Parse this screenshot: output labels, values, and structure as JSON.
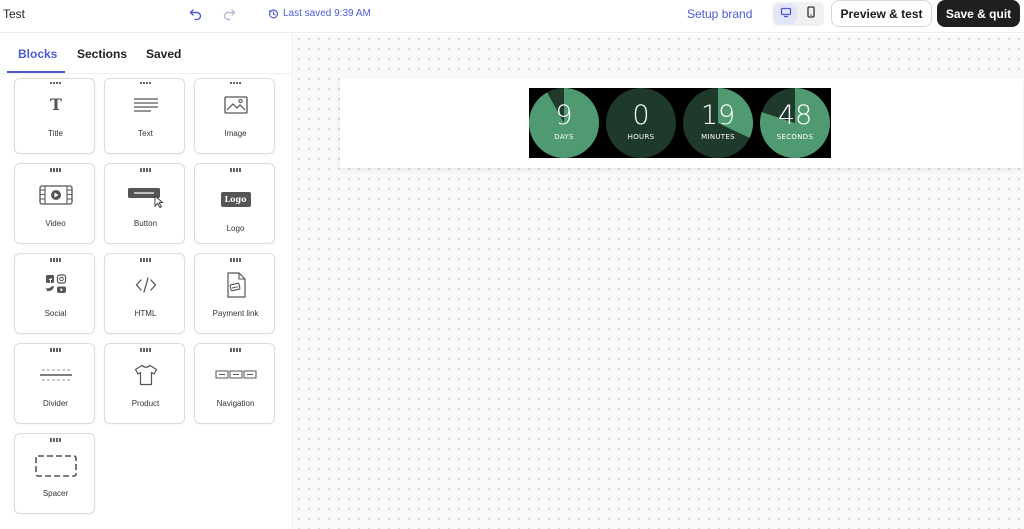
{
  "header": {
    "doc_title": "Test",
    "last_saved": "Last saved 9:39 AM",
    "setup_brand": "Setup brand",
    "preview_label": "Preview & test",
    "save_label": "Save & quit"
  },
  "sidebar": {
    "tabs": [
      {
        "label": "Blocks",
        "active": true
      },
      {
        "label": "Sections",
        "active": false
      },
      {
        "label": "Saved",
        "active": false
      }
    ],
    "blocks": [
      {
        "label": "Title",
        "icon": "title-icon"
      },
      {
        "label": "Text",
        "icon": "text-icon"
      },
      {
        "label": "Image",
        "icon": "image-icon"
      },
      {
        "label": "Video",
        "icon": "video-icon"
      },
      {
        "label": "Button",
        "icon": "button-icon"
      },
      {
        "label": "Logo",
        "icon": "logo-icon",
        "icon_text": "Logo"
      },
      {
        "label": "Social",
        "icon": "social-icon"
      },
      {
        "label": "HTML",
        "icon": "html-icon"
      },
      {
        "label": "Payment link",
        "icon": "payment-link-icon"
      },
      {
        "label": "Divider",
        "icon": "divider-icon"
      },
      {
        "label": "Product",
        "icon": "product-icon"
      },
      {
        "label": "Navigation",
        "icon": "navigation-icon"
      },
      {
        "label": "Spacer",
        "icon": "spacer-icon"
      }
    ]
  },
  "countdown": {
    "units": [
      {
        "value": "9",
        "label": "DAYS"
      },
      {
        "value": "0",
        "label": "HOURS"
      },
      {
        "value": "19",
        "label": "MINUTES"
      },
      {
        "value": "48",
        "label": "SECONDS"
      }
    ],
    "colors": {
      "dark": "#1f3a2b",
      "light": "#4f9a70",
      "bg": "#000000"
    }
  },
  "colors": {
    "accent": "#4b5bd1",
    "primary_button": "#1f1f1f"
  }
}
